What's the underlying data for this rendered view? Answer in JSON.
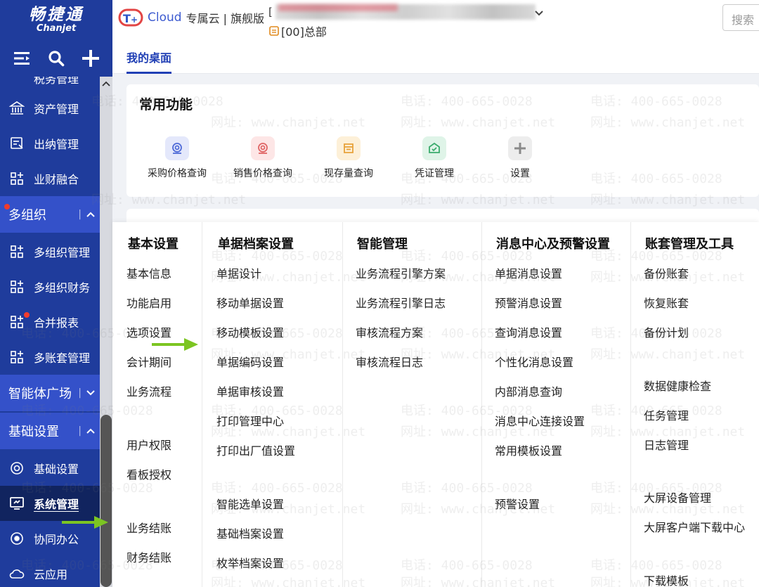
{
  "sidebar": {
    "logo_cn": "畅捷通",
    "logo_en": "Chanjet",
    "top_partial_label": "税务管理",
    "items_top": [
      {
        "label": "资产管理",
        "icon": "bank-icon"
      },
      {
        "label": "出纳管理",
        "icon": "cashier-icon"
      },
      {
        "label": "业财融合",
        "icon": "grid-icon"
      }
    ],
    "group_multi_org": {
      "label": "多组织",
      "separator": "|"
    },
    "items_multi_org": [
      {
        "label": "多组织管理"
      },
      {
        "label": "多组织财务"
      },
      {
        "label": "合并报表"
      },
      {
        "label": "多账套管理"
      }
    ],
    "group_agent": {
      "label": "智能体广场",
      "separator": "|"
    },
    "group_basic": {
      "label": "基础设置",
      "separator": "|"
    },
    "items_basic": [
      {
        "label": "基础设置"
      },
      {
        "label": "系统管理"
      },
      {
        "label": "协同办公"
      },
      {
        "label": "云应用"
      }
    ]
  },
  "topbar": {
    "brand_text": "Cloud",
    "brand_sub": "专属云 | 旗舰版",
    "org_bracket": "[",
    "org_name": "[00]总部",
    "search_placeholder": "搜索"
  },
  "tabs": [
    {
      "label": "我的桌面"
    }
  ],
  "common": {
    "title": "常用功能",
    "items": [
      {
        "label": "采购价格查询",
        "bg": "#e4e8fb",
        "fg": "#4f6bd8"
      },
      {
        "label": "销售价格查询",
        "bg": "#fde6e6",
        "fg": "#e06666"
      },
      {
        "label": "现存量查询",
        "bg": "#fdf0d8",
        "fg": "#e8a23a"
      },
      {
        "label": "凭证管理",
        "bg": "#dff4e8",
        "fg": "#3aab6c"
      },
      {
        "label": "设置",
        "bg": "#ededed",
        "fg": "#8a8a8a"
      }
    ]
  },
  "menu": {
    "columns": [
      {
        "title": "基本设置",
        "links": [
          "基本信息",
          "功能启用",
          "选项设置",
          "会计期间",
          "业务流程",
          "用户权限",
          "看板授权",
          "业务结账",
          "财务结账"
        ]
      },
      {
        "title": "单据档案设置",
        "links": [
          "单据设计",
          "移动单据设置",
          "移动模板设置",
          "单据编码设置",
          "单据审核设置",
          "打印管理中心",
          "打印出厂值设置",
          "智能选单设置",
          "基础档案设置",
          "枚举档案设置"
        ]
      },
      {
        "title": "智能管理",
        "links": [
          "业务流程引擎方案",
          "业务流程引擎日志",
          "审核流程方案",
          "审核流程日志"
        ]
      },
      {
        "title": "消息中心及预警设置",
        "links": [
          "单据消息设置",
          "预警消息设置",
          "查询消息设置",
          "个性化消息设置",
          "内部消息查询",
          "消息中心连接设置",
          "常用模板设置",
          "预警设置"
        ]
      },
      {
        "title": "账套管理及工具",
        "links": [
          "备份账套",
          "恢复账套",
          "备份计划",
          "数据健康检查",
          "任务管理",
          "日志管理",
          "大屏设备管理",
          "大屏客户端下载中心",
          "下载模板"
        ]
      }
    ]
  },
  "watermark": {
    "phone": "电话: 400-665-0028",
    "site": "网址: www.chanjet.net"
  },
  "colors": {
    "sidebar": "#1f3c9c",
    "group": "#3451c9",
    "active": "#11245f",
    "accent": "#2140b5",
    "arrow": "#7cc522"
  }
}
